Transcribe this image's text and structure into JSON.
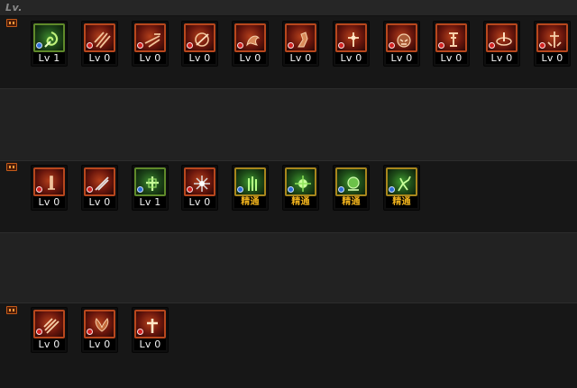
{
  "header": {
    "title": "Lv."
  },
  "rows": [
    {
      "skills": [
        {
          "name": "skill-1-1",
          "style": "green",
          "lv_label": "Lv 1",
          "icon": "whirlwind-icon"
        },
        {
          "name": "skill-1-2",
          "style": "red",
          "lv_label": "Lv 0",
          "icon": "claw-slash-icon"
        },
        {
          "name": "skill-1-3",
          "style": "red",
          "lv_label": "Lv 0",
          "icon": "dash-strike-icon"
        },
        {
          "name": "skill-1-4",
          "style": "red",
          "lv_label": "Lv 0",
          "icon": "spin-kick-icon"
        },
        {
          "name": "skill-1-5",
          "style": "red",
          "lv_label": "Lv 0",
          "icon": "dragon-icon"
        },
        {
          "name": "skill-1-6",
          "style": "red",
          "lv_label": "Lv 0",
          "icon": "uppercut-icon"
        },
        {
          "name": "skill-1-7",
          "style": "red",
          "lv_label": "Lv 0",
          "icon": "cross-slash-icon"
        },
        {
          "name": "skill-1-8",
          "style": "red",
          "lv_label": "Lv 0",
          "icon": "beast-roar-icon"
        },
        {
          "name": "skill-1-9",
          "style": "red",
          "lv_label": "Lv 0",
          "icon": "pillar-icon"
        },
        {
          "name": "skill-1-10",
          "style": "red",
          "lv_label": "Lv 0",
          "icon": "vortex-icon"
        },
        {
          "name": "skill-1-11",
          "style": "red",
          "lv_label": "Lv 0",
          "icon": "impale-icon"
        }
      ]
    },
    {
      "skills": [
        {
          "name": "skill-2-1",
          "style": "red",
          "lv_label": "Lv 0",
          "icon": "blade-stand-icon"
        },
        {
          "name": "skill-2-2",
          "style": "red",
          "lv_label": "Lv 0",
          "icon": "diagonal-slash-icon"
        },
        {
          "name": "skill-2-3",
          "style": "green",
          "lv_label": "Lv 1",
          "icon": "armor-cross-icon"
        },
        {
          "name": "skill-2-4",
          "style": "red",
          "lv_label": "Lv 0",
          "icon": "star-burst-icon"
        },
        {
          "name": "skill-2-5",
          "style": "gold",
          "lv_label": "精通",
          "icon": "green-pillar-icon"
        },
        {
          "name": "skill-2-6",
          "style": "gold",
          "lv_label": "精通",
          "icon": "green-burst-icon"
        },
        {
          "name": "skill-2-7",
          "style": "gold",
          "lv_label": "精通",
          "icon": "spirit-icon"
        },
        {
          "name": "skill-2-8",
          "style": "gold",
          "lv_label": "精通",
          "icon": "leaping-warrior-icon"
        }
      ]
    },
    {
      "skills": [
        {
          "name": "skill-3-1",
          "style": "red",
          "lv_label": "Lv 0",
          "icon": "triple-slash-icon"
        },
        {
          "name": "skill-3-2",
          "style": "red",
          "lv_label": "Lv 0",
          "icon": "wings-icon"
        },
        {
          "name": "skill-3-3",
          "style": "red",
          "lv_label": "Lv 0",
          "icon": "holy-cross-icon"
        }
      ]
    }
  ],
  "colors": {
    "red_border": "#b8471d",
    "green_border": "#5f8a2a",
    "mastered_text": "#f0b21c"
  }
}
